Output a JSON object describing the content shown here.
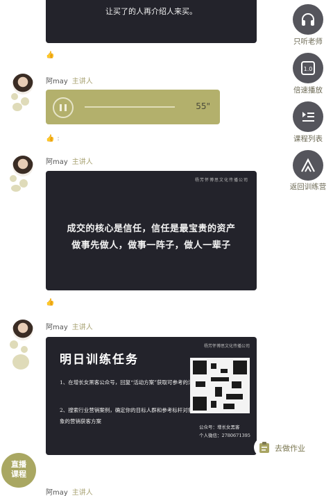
{
  "top_card": {
    "line1": "让买了的人再介绍人来买。"
  },
  "messages": [
    {
      "speaker": "阿may",
      "role": "主讲人"
    },
    {
      "speaker": "阿may",
      "role": "主讲人"
    },
    {
      "speaker": "阿may",
      "role": "主讲人"
    },
    {
      "speaker": "阿may",
      "role": "主讲人"
    }
  ],
  "like_colon": ":",
  "audio": {
    "duration": "55\""
  },
  "quote_card": {
    "brand": "杨芳怀博思文化传播公司",
    "line1": "成交的核心是信任，信任是最宝贵的资产",
    "line2": "做事先做人，做事一阵子，做人一辈子"
  },
  "task_card": {
    "title": "明日训练任务",
    "brand": "杨芳怀博思文化传播公司",
    "item1": "1、在增长女黑客公众号，回复“活动方案”获取可参考的活动传播方案模板",
    "item2": "2、搜索行业营销案例，确定你的目标人群和参考标杆对象，并拆解标杆对象的营销获客方案",
    "qr_caption1": "公众号：增长女黑客",
    "qr_caption2": "个人微信：2780671395"
  },
  "sidebar": [
    {
      "label": "只听老师",
      "icon": "headphones-icon"
    },
    {
      "label": "倍速播放",
      "icon": "speed-icon"
    },
    {
      "label": "课程列表",
      "icon": "list-icon"
    },
    {
      "label": "返回训练营",
      "icon": "return-icon"
    }
  ],
  "homework": {
    "label": "去做作业"
  },
  "badge": {
    "line1": "直播",
    "line2": "课程"
  },
  "colors": {
    "accent": "#b3b06c",
    "dark_card": "#23232b",
    "side_button": "#55555c"
  }
}
